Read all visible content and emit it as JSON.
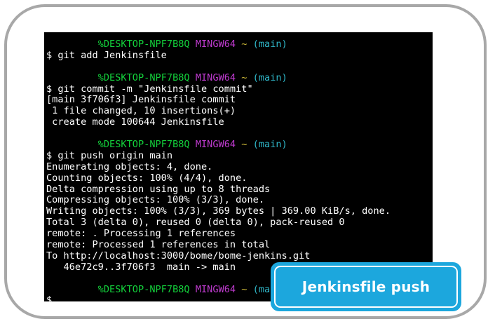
{
  "terminal": {
    "prompt": {
      "user_host": "%DESKTOP-NPF7B8Q",
      "shell": "MINGW64",
      "tilde": "~",
      "branch": "(main)"
    },
    "blocks": [
      {
        "lines": [
          "$ git add Jenkinsfile"
        ]
      },
      {
        "lines": [
          "$ git commit -m \"Jenkinsfile commit\"",
          "[main 3f706f3] Jenkinsfile commit",
          " 1 file changed, 10 insertions(+)",
          " create mode 100644 Jenkinsfile"
        ]
      },
      {
        "lines": [
          "$ git push origin main",
          "Enumerating objects: 4, done.",
          "Counting objects: 100% (4/4), done.",
          "Delta compression using up to 8 threads",
          "Compressing objects: 100% (3/3), done.",
          "Writing objects: 100% (3/3), 369 bytes | 369.00 KiB/s, done.",
          "Total 3 (delta 0), reused 0 (delta 0), pack-reused 0",
          "remote: . Processing 1 references",
          "remote: Processed 1 references in total",
          "To http://localhost:3000/bome/bome-jenkins.git",
          "   46e72c9..3f706f3  main -> main"
        ]
      },
      {
        "lines": [
          "$"
        ]
      }
    ]
  },
  "callout": {
    "label": "Jenkinsfile push"
  },
  "colors": {
    "user_host": "#13d13b",
    "shell": "#c03bd0",
    "tilde": "#d6c13a",
    "branch": "#2fb7c9",
    "callout_bg": "#1ca7dd"
  }
}
